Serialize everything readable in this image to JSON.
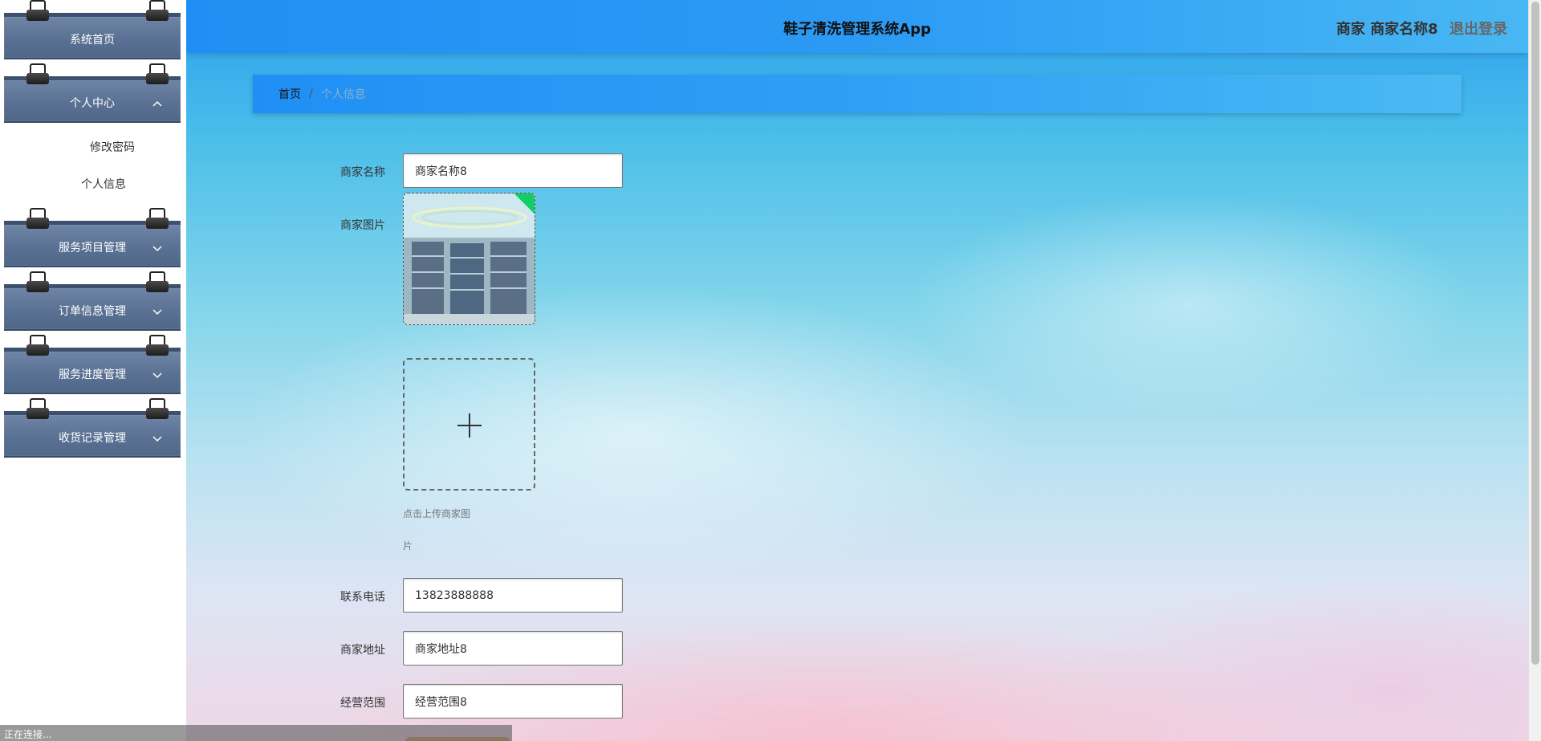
{
  "app": {
    "title": "鞋子清洗管理系统App",
    "role": "商家",
    "username": "商家名称8",
    "logout_label": "退出登录"
  },
  "sidebar": {
    "items": [
      {
        "label": "系统首页",
        "expandable": false
      },
      {
        "label": "个人中心",
        "expandable": true,
        "expanded": true,
        "children": [
          {
            "label": "修改密码"
          },
          {
            "label": "个人信息"
          }
        ]
      },
      {
        "label": "服务项目管理",
        "expandable": true,
        "expanded": false
      },
      {
        "label": "订单信息管理",
        "expandable": true,
        "expanded": false
      },
      {
        "label": "服务进度管理",
        "expandable": true,
        "expanded": false
      },
      {
        "label": "收货记录管理",
        "expandable": true,
        "expanded": false
      }
    ]
  },
  "breadcrumb": {
    "home": "首页",
    "separator": "/",
    "current": "个人信息"
  },
  "form": {
    "name_label": "商家名称",
    "name_value": "商家名称8",
    "image_label": "商家图片",
    "upload_tip_line1": "点击上传商家图",
    "upload_tip_line2": "片",
    "phone_label": "联系电话",
    "phone_value": "13823888888",
    "address_label": "商家地址",
    "address_value": "商家地址8",
    "scope_label": "经营范围",
    "scope_value": "经营范围8"
  },
  "status_bar": {
    "text": "正在连接..."
  },
  "colors": {
    "topbar": "#2c9af4",
    "sidebar_menu": "#5a7193",
    "upload_success_corner": "#13ce66"
  }
}
